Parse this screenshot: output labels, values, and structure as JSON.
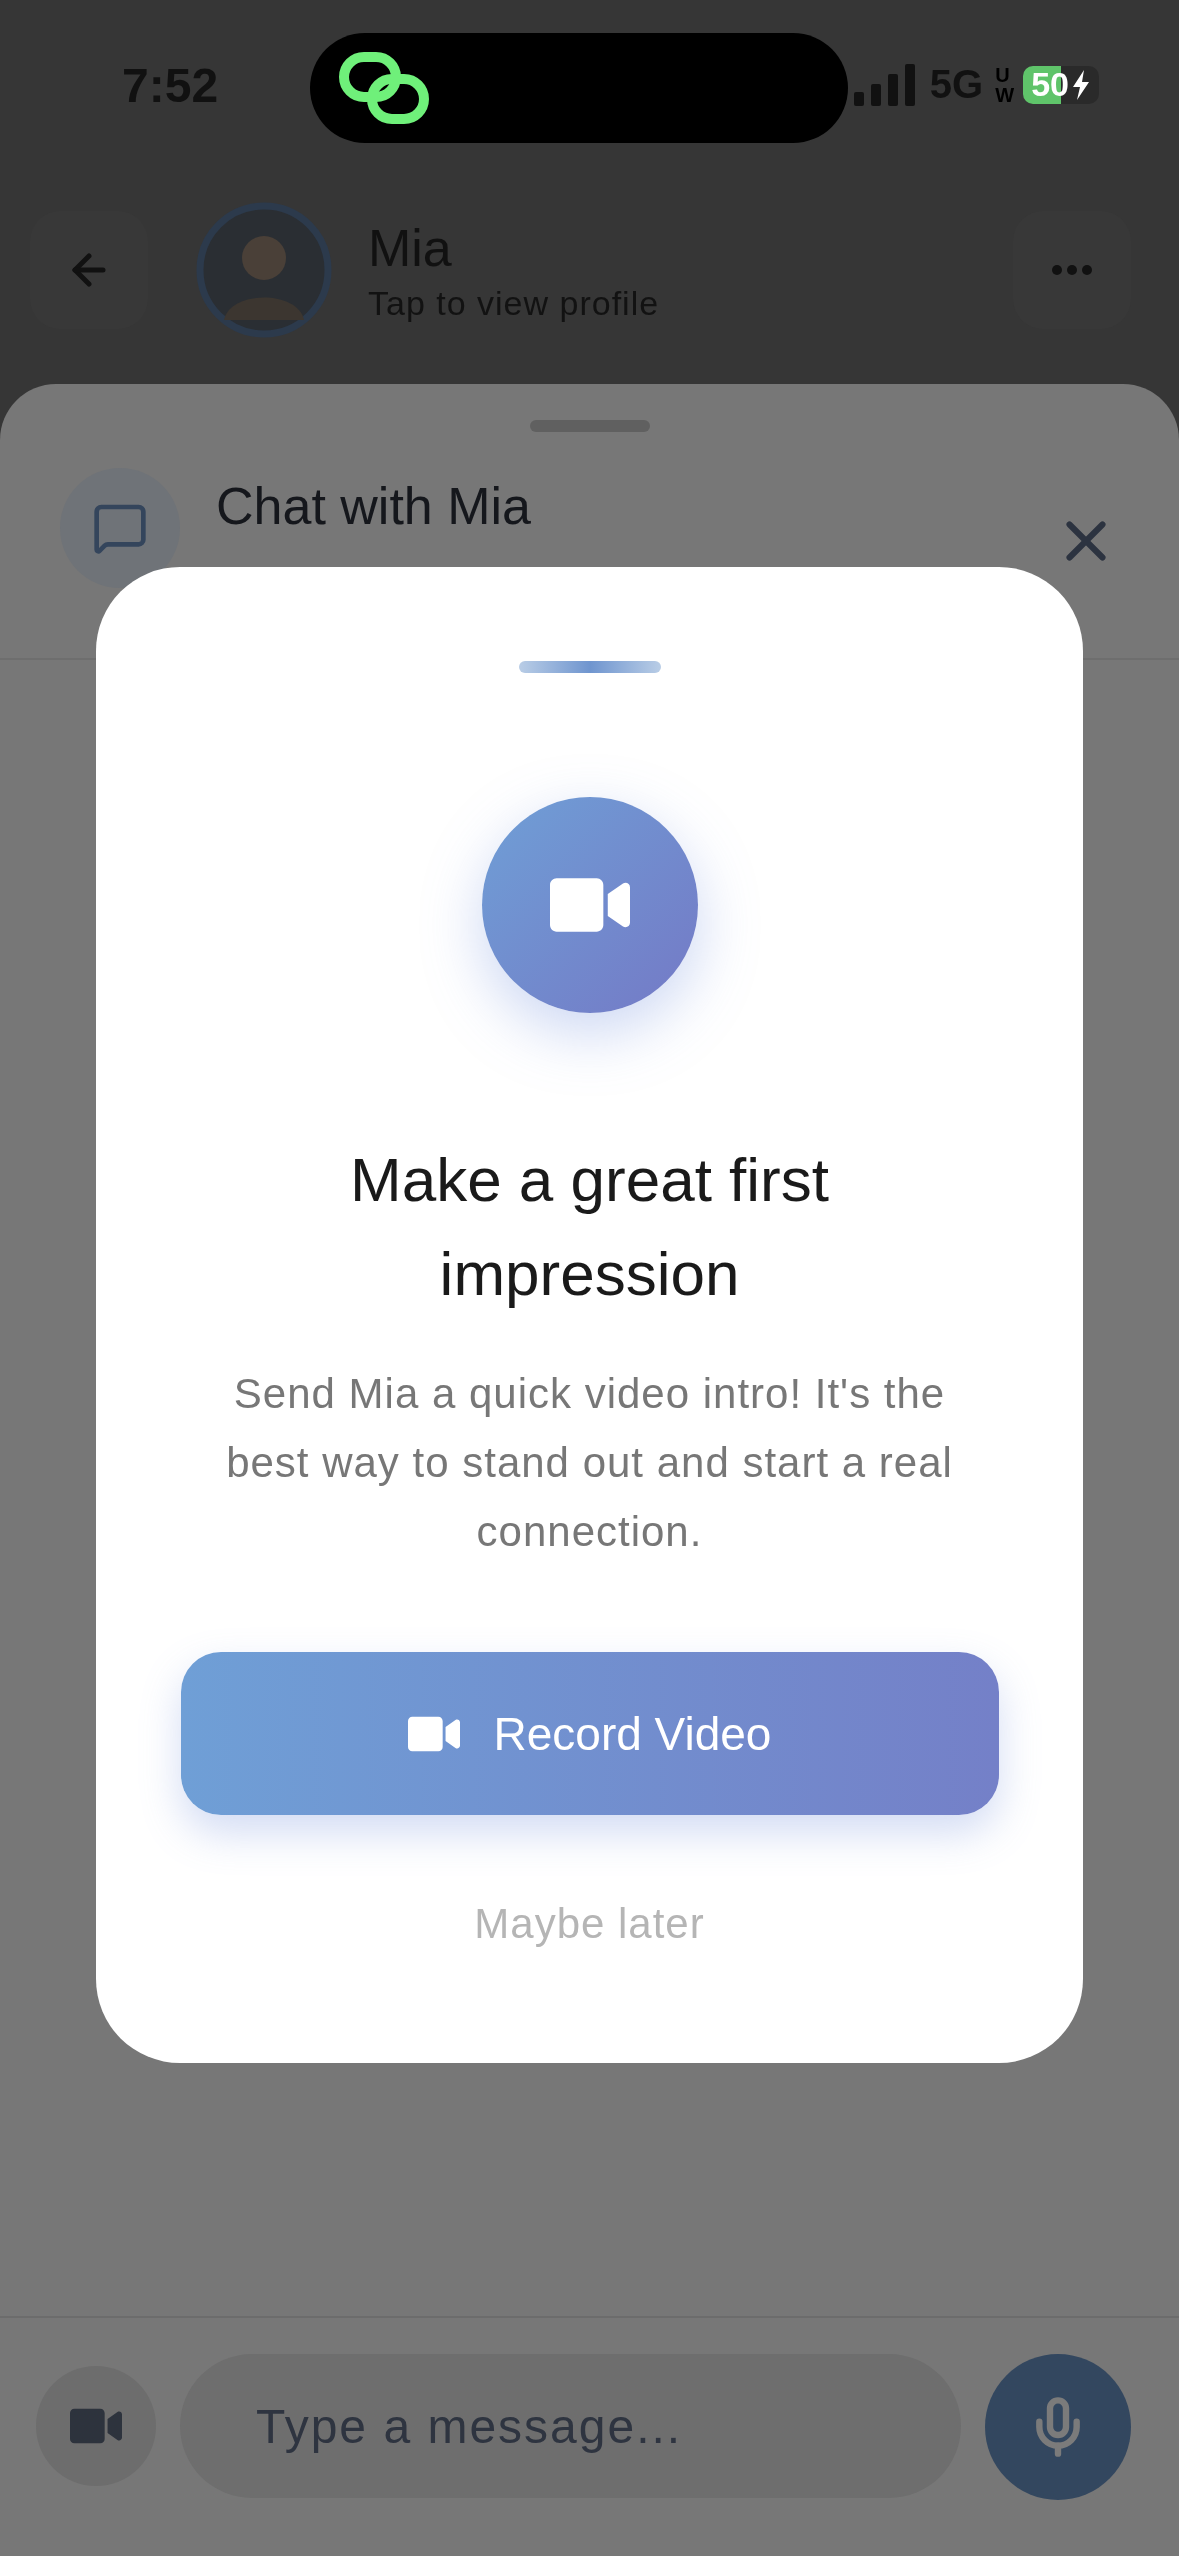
{
  "status_bar": {
    "time": "7:52",
    "network": "5G",
    "network_badge": "UW",
    "battery": "50"
  },
  "header": {
    "name": "Mia",
    "subtitle": "Tap to view profile"
  },
  "sheet": {
    "title": "Chat with Mia"
  },
  "modal": {
    "title": "Make a great first impression",
    "body": "Send Mia a quick video intro! It's the best way to stand out and start a real connection.",
    "primary_button": "Record Video",
    "secondary_button": "Maybe later"
  },
  "composer": {
    "placeholder": "Type a message..."
  }
}
